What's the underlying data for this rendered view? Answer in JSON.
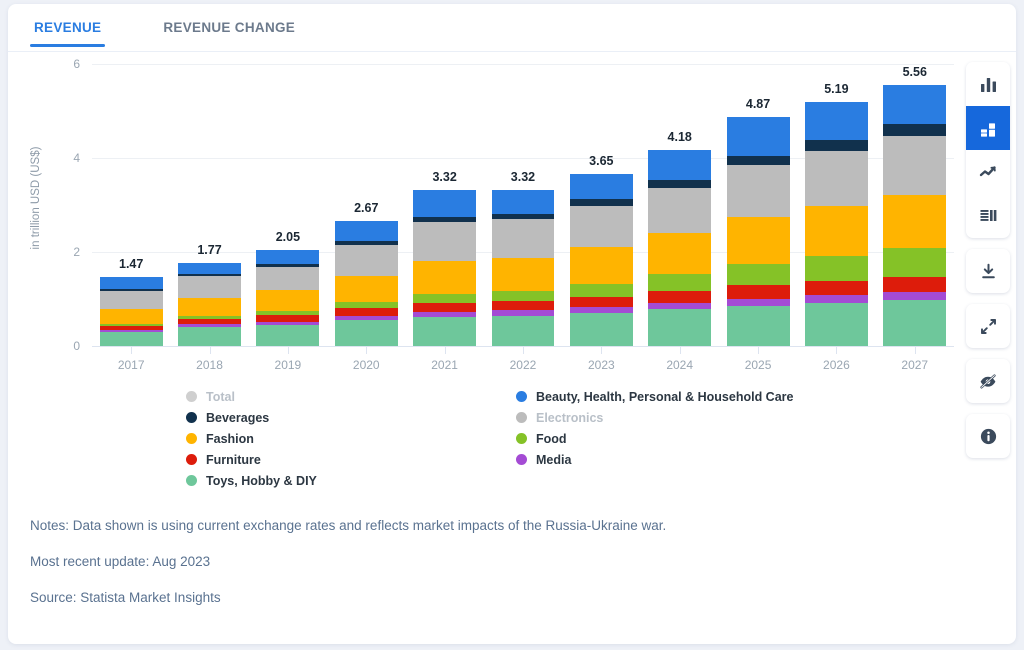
{
  "tabs": [
    {
      "label": "REVENUE",
      "active": true
    },
    {
      "label": "REVENUE CHANGE",
      "active": false
    }
  ],
  "chart_data": {
    "type": "bar",
    "stacked": true,
    "title": "",
    "xlabel": "",
    "ylabel": "in trillion USD (US$)",
    "ylim": [
      0,
      6
    ],
    "yticks": [
      "0",
      "2",
      "4",
      "6"
    ],
    "grid": true,
    "legend_position": "bottom",
    "categories": [
      "2017",
      "2018",
      "2019",
      "2020",
      "2021",
      "2022",
      "2023",
      "2024",
      "2025",
      "2026",
      "2027"
    ],
    "totals": [
      "1.47",
      "1.77",
      "2.05",
      "2.67",
      "3.32",
      "3.32",
      "3.65",
      "4.18",
      "4.87",
      "5.19",
      "5.56"
    ],
    "series": [
      {
        "name": "Toys, Hobby & DIY",
        "color": "#6ec79b",
        "values": [
          0.3,
          0.4,
          0.45,
          0.55,
          0.62,
          0.64,
          0.7,
          0.78,
          0.86,
          0.92,
          0.98
        ]
      },
      {
        "name": "Media",
        "color": "#a44bd4",
        "values": [
          0.04,
          0.06,
          0.07,
          0.09,
          0.11,
          0.12,
          0.13,
          0.14,
          0.15,
          0.16,
          0.17
        ]
      },
      {
        "name": "Furniture",
        "color": "#dd1c0b",
        "values": [
          0.08,
          0.11,
          0.13,
          0.16,
          0.19,
          0.2,
          0.22,
          0.25,
          0.28,
          0.3,
          0.32
        ]
      },
      {
        "name": "Food",
        "color": "#85c227",
        "values": [
          0.05,
          0.07,
          0.1,
          0.14,
          0.19,
          0.22,
          0.28,
          0.36,
          0.46,
          0.54,
          0.62
        ]
      },
      {
        "name": "Fashion",
        "color": "#ffb400",
        "values": [
          0.32,
          0.39,
          0.44,
          0.56,
          0.7,
          0.7,
          0.78,
          0.87,
          0.99,
          1.06,
          1.13
        ]
      },
      {
        "name": "Electronics",
        "color": "#bcbcbc",
        "values": [
          0.38,
          0.45,
          0.5,
          0.66,
          0.83,
          0.82,
          0.88,
          0.97,
          1.11,
          1.18,
          1.25
        ]
      },
      {
        "name": "Beverages",
        "color": "#11314d",
        "values": [
          0.04,
          0.05,
          0.06,
          0.08,
          0.1,
          0.11,
          0.13,
          0.16,
          0.19,
          0.22,
          0.25
        ]
      },
      {
        "name": "Beauty, Health, Personal & Household Care",
        "color": "#2a7de1",
        "values": [
          0.26,
          0.24,
          0.3,
          0.43,
          0.58,
          0.51,
          0.53,
          0.65,
          0.83,
          0.81,
          0.84
        ]
      }
    ]
  },
  "legend": {
    "left_column": [
      {
        "label": "Total",
        "color": "#cfcfcf",
        "muted": true
      },
      {
        "label": "Beverages",
        "color": "#11314d",
        "muted": false
      },
      {
        "label": "Fashion",
        "color": "#ffb400",
        "muted": false
      },
      {
        "label": "Furniture",
        "color": "#dd1c0b",
        "muted": false
      },
      {
        "label": "Toys, Hobby & DIY",
        "color": "#6ec79b",
        "muted": false
      }
    ],
    "right_column": [
      {
        "label": "Beauty, Health, Personal & Household Care",
        "color": "#2a7de1",
        "muted": false
      },
      {
        "label": "Electronics",
        "color": "#bcbcbc",
        "muted": true
      },
      {
        "label": "Food",
        "color": "#85c227",
        "muted": false
      },
      {
        "label": "Media",
        "color": "#a44bd4",
        "muted": false
      }
    ]
  },
  "footer": {
    "notes": "Notes: Data shown is using current exchange rates and reflects market impacts of the Russia-Ukraine war.",
    "update": "Most recent update: Aug 2023",
    "source": "Source: Statista Market Insights"
  },
  "toolbar": {
    "chart_type_buttons": [
      {
        "name": "bar-chart-icon",
        "active": false
      },
      {
        "name": "stacked-bar-chart-icon",
        "active": true
      },
      {
        "name": "line-chart-icon",
        "active": false
      },
      {
        "name": "table-icon",
        "active": false
      }
    ],
    "action_buttons": [
      {
        "name": "download-icon"
      },
      {
        "name": "expand-icon"
      },
      {
        "name": "eye-slash-icon"
      },
      {
        "name": "info-icon"
      }
    ]
  },
  "colors": {
    "accent": "#2a7de1",
    "active_toolbar": "#1668dc",
    "footer_text": "#5a7290",
    "page_background": "#eef1f7"
  }
}
